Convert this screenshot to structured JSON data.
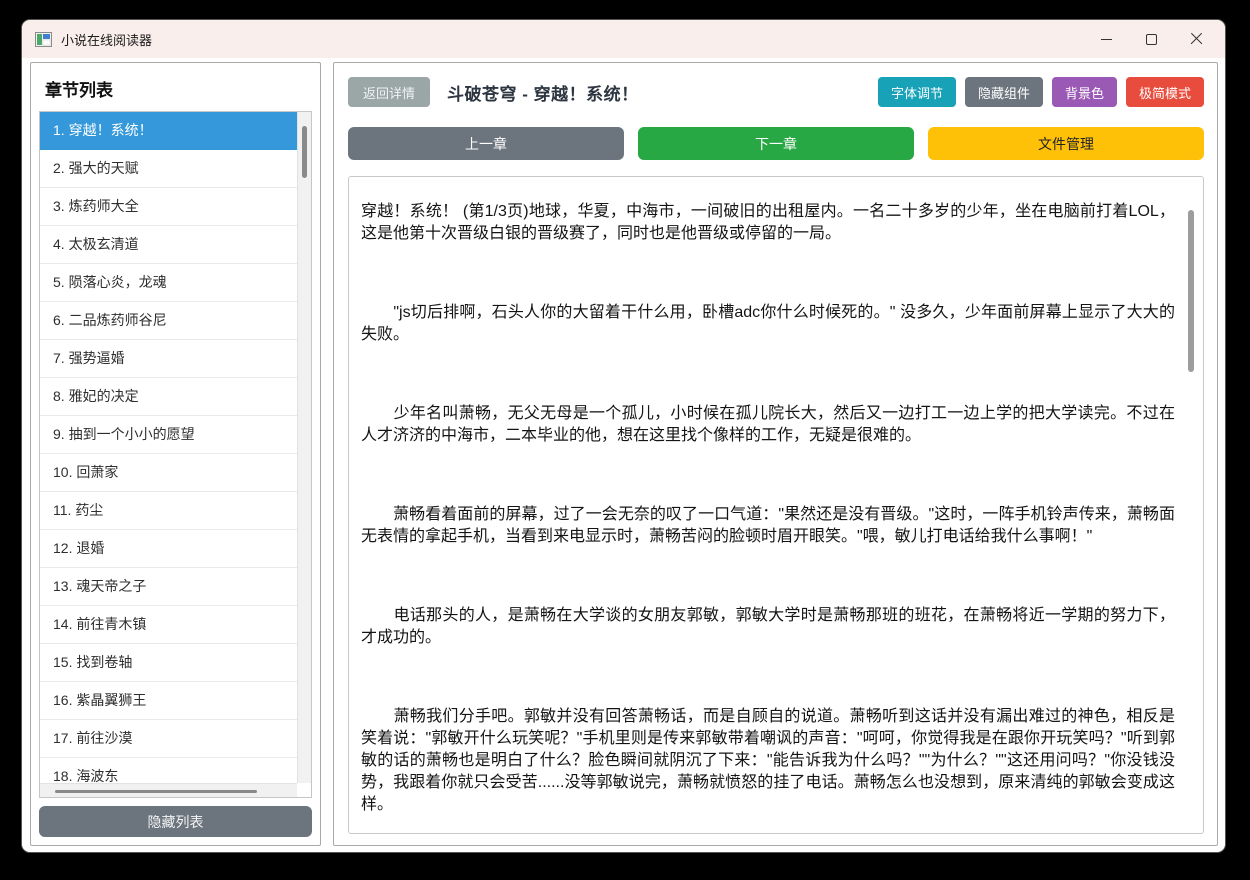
{
  "window": {
    "title": "小说在线阅读器"
  },
  "icons": {
    "app": "novel-reader-app-icon",
    "minimize": "minimize-icon",
    "maximize": "maximize-icon",
    "close": "close-icon"
  },
  "colors": {
    "titlebar": "#f9eeec",
    "selected_chapter": "#3498db",
    "font_adjust": "#17a2b8",
    "hide_widgets": "#6c757d",
    "background_color_btn": "#9b59b6",
    "minimal_mode": "#e74c3c",
    "prev_chapter": "#6c757d",
    "next_chapter": "#28a745",
    "file_manager": "#ffc107",
    "back_button": "#9ba6a7",
    "hide_list": "#6c757d"
  },
  "sidebar": {
    "header": "章节列表",
    "hide_button": "隐藏列表",
    "chapters": [
      {
        "label": "1. 穿越！系统！",
        "selected": true
      },
      {
        "label": "2. 强大的天赋"
      },
      {
        "label": "3. 炼药师大全"
      },
      {
        "label": "4. 太极玄清道"
      },
      {
        "label": "5. 陨落心炎，龙魂"
      },
      {
        "label": "6. 二品炼药师谷尼"
      },
      {
        "label": "7. 强势逼婚"
      },
      {
        "label": "8. 雅妃的决定"
      },
      {
        "label": "9. 抽到一个小小的愿望"
      },
      {
        "label": "10. 回萧家"
      },
      {
        "label": "11. 药尘"
      },
      {
        "label": "12. 退婚"
      },
      {
        "label": "13. 魂天帝之子"
      },
      {
        "label": "14. 前往青木镇"
      },
      {
        "label": "15. 找到卷轴"
      },
      {
        "label": "16. 紫晶翼狮王"
      },
      {
        "label": "17. 前往沙漠"
      },
      {
        "label": "18. 海波东"
      }
    ]
  },
  "reader": {
    "back_button": "返回详情",
    "title": "斗破苍穹 - 穿越！系统！",
    "toolbar": [
      {
        "label": "字体调节",
        "color": "#17a2b8"
      },
      {
        "label": "隐藏组件",
        "color": "#6c757d"
      },
      {
        "label": "背景色",
        "color": "#9b59b6"
      },
      {
        "label": "极简模式",
        "color": "#e74c3c"
      }
    ],
    "nav": {
      "prev": "上一章",
      "next": "下一章",
      "files": "文件管理"
    },
    "paragraphs": [
      "穿越！系统！ (第1/3页)地球，华夏，中海市，一间破旧的出租屋内。一名二十多岁的少年，坐在电脑前打着LOL，这是他第十次晋级白银的晋级赛了，同时也是他晋级或停留的一局。",
      "　　\"js切后排啊，石头人你的大留着干什么用，卧槽adc你什么时候死的。\" 没多久，少年面前屏幕上显示了大大的失败。",
      "　　少年名叫萧畅，无父无母是一个孤儿，小时候在孤儿院长大，然后又一边打工一边上学的把大学读完。不过在人才济济的中海市，二本毕业的他，想在这里找个像样的工作，无疑是很难的。",
      "　　萧畅看着面前的屏幕，过了一会无奈的叹了一口气道：\"果然还是没有晋级。\"这时，一阵手机铃声传来，萧畅面无表情的拿起手机，当看到来电显示时，萧畅苦闷的脸顿时眉开眼笑。\"喂，敏儿打电话给我什么事啊！\"",
      "　　电话那头的人，是萧畅在大学谈的女朋友郭敏，郭敏大学时是萧畅那班的班花，在萧畅将近一学期的努力下，才成功的。",
      "　　萧畅我们分手吧。郭敏并没有回答萧畅话，而是自顾自的说道。萧畅听到这话并没有漏出难过的神色，相反是笑着说：\"郭敏开什么玩笑呢？\"手机里则是传来郭敏带着嘲讽的声音：\"呵呵，你觉得我是在跟你开玩笑吗？\"听到郭敏的话的萧畅也是明白了什么？脸色瞬间就阴沉了下来：\"能告诉我为什么吗？\"\"为什么？\"\"这还用问吗？\"你没钱没势，我跟着你就只会受苦......没等郭敏说完，萧畅就愤怒的挂了电话。萧畅怎么也没想到，原来清纯的郭敏会变成这样。"
    ]
  }
}
